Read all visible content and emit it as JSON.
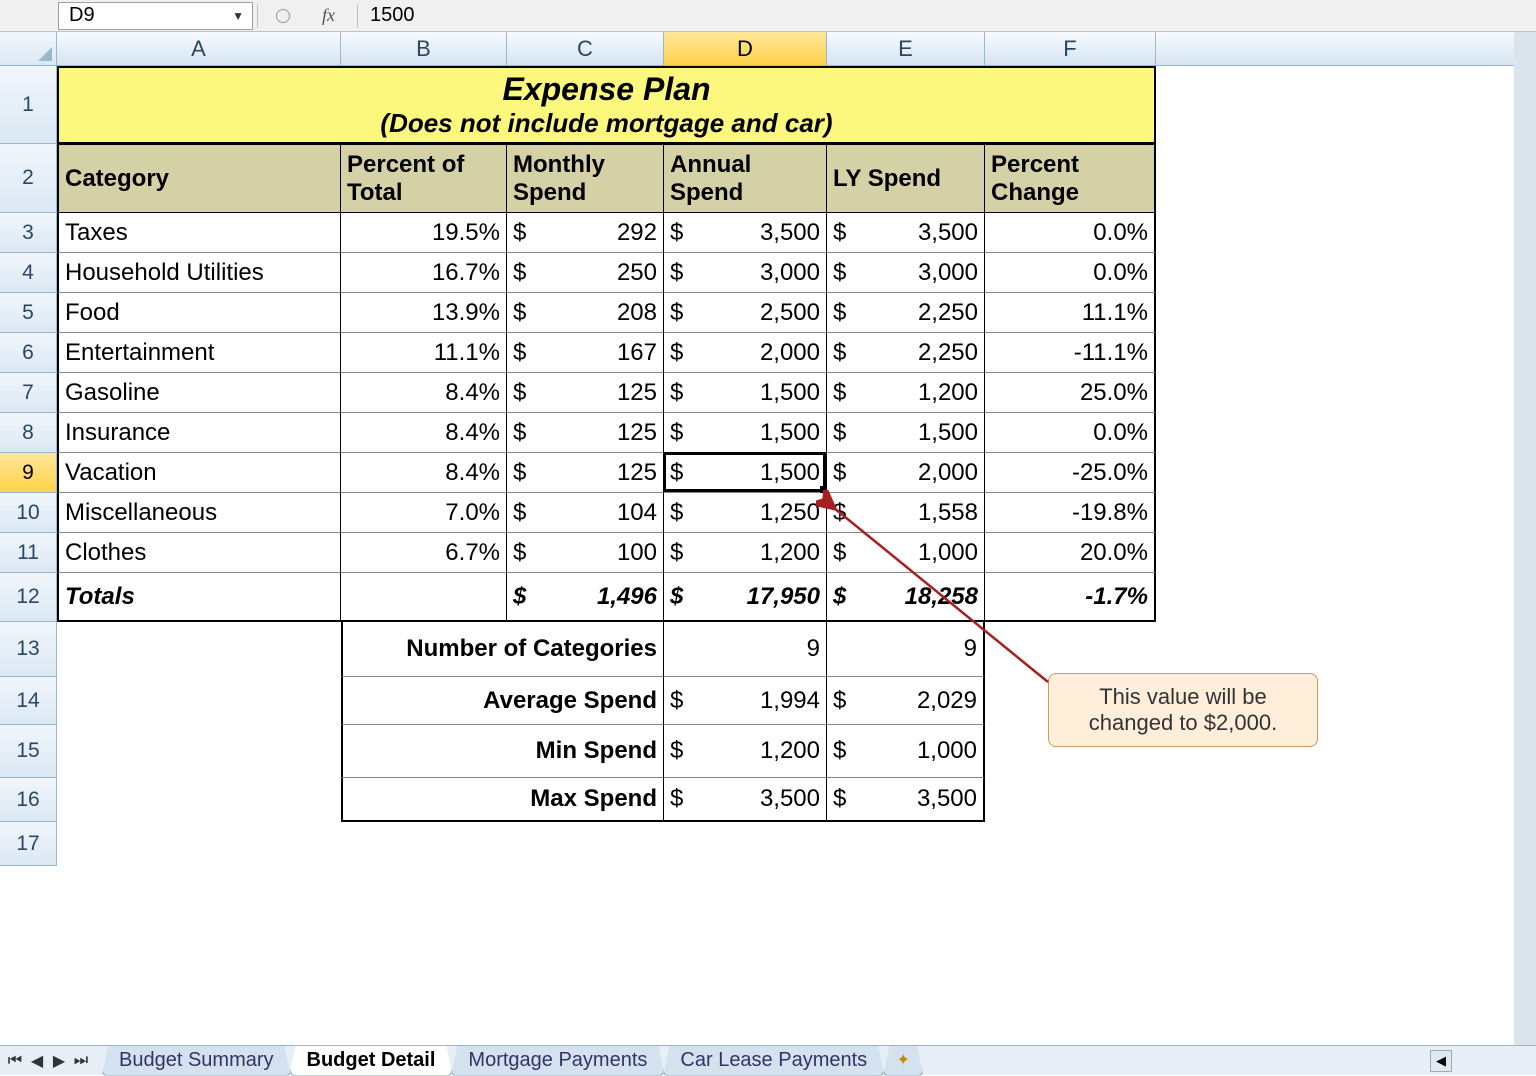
{
  "formula_bar": {
    "name_box": "D9",
    "fx": "fx",
    "value": "1500"
  },
  "columns": [
    "A",
    "B",
    "C",
    "D",
    "E",
    "F"
  ],
  "col_widths": {
    "A": 284,
    "B": 166,
    "C": 157,
    "D": 163,
    "E": 158,
    "F": 171
  },
  "selected_col": "D",
  "selected_row": 9,
  "row_heights": {
    "1": 78,
    "2": 69,
    "default": 40,
    "r12": 49,
    "gap_r13": 55
  },
  "title": {
    "line1": "Expense Plan",
    "line2": "(Does not include mortgage and car)"
  },
  "headers": [
    "Category",
    "Percent of Total",
    "Monthly Spend",
    "Annual Spend",
    "LY Spend",
    "Percent Change"
  ],
  "rows": [
    {
      "cat": "Taxes",
      "pct": "19.5%",
      "mon": "292",
      "ann": "3,500",
      "ly": "3,500",
      "chg": "0.0%"
    },
    {
      "cat": "Household Utilities",
      "pct": "16.7%",
      "mon": "250",
      "ann": "3,000",
      "ly": "3,000",
      "chg": "0.0%"
    },
    {
      "cat": "Food",
      "pct": "13.9%",
      "mon": "208",
      "ann": "2,500",
      "ly": "2,250",
      "chg": "11.1%"
    },
    {
      "cat": "Entertainment",
      "pct": "11.1%",
      "mon": "167",
      "ann": "2,000",
      "ly": "2,250",
      "chg": "-11.1%"
    },
    {
      "cat": "Gasoline",
      "pct": "8.4%",
      "mon": "125",
      "ann": "1,500",
      "ly": "1,200",
      "chg": "25.0%"
    },
    {
      "cat": "Insurance",
      "pct": "8.4%",
      "mon": "125",
      "ann": "1,500",
      "ly": "1,500",
      "chg": "0.0%"
    },
    {
      "cat": "Vacation",
      "pct": "8.4%",
      "mon": "125",
      "ann": "1,500",
      "ly": "2,000",
      "chg": "-25.0%"
    },
    {
      "cat": "Miscellaneous",
      "pct": "7.0%",
      "mon": "104",
      "ann": "1,250",
      "ly": "1,558",
      "chg": "-19.8%"
    },
    {
      "cat": "Clothes",
      "pct": "6.7%",
      "mon": "100",
      "ann": "1,200",
      "ly": "1,000",
      "chg": "20.0%"
    }
  ],
  "totals": {
    "label": "Totals",
    "mon": "1,496",
    "ann": "17,950",
    "ly": "18,258",
    "chg": "-1.7%"
  },
  "summary": [
    {
      "label": "Number of Categories",
      "d": "9",
      "e": "9",
      "curr": false
    },
    {
      "label": "Average Spend",
      "d": "1,994",
      "e": "2,029",
      "curr": true
    },
    {
      "label": "Min Spend",
      "d": "1,200",
      "e": "1,000",
      "curr": true
    },
    {
      "label": "Max Spend",
      "d": "3,500",
      "e": "3,500",
      "curr": true
    }
  ],
  "callout": "This value will be changed to $2,000.",
  "tabs": [
    "Budget Summary",
    "Budget Detail",
    "Mortgage Payments",
    "Car Lease Payments"
  ],
  "active_tab": 1,
  "currency_symbol": "$"
}
